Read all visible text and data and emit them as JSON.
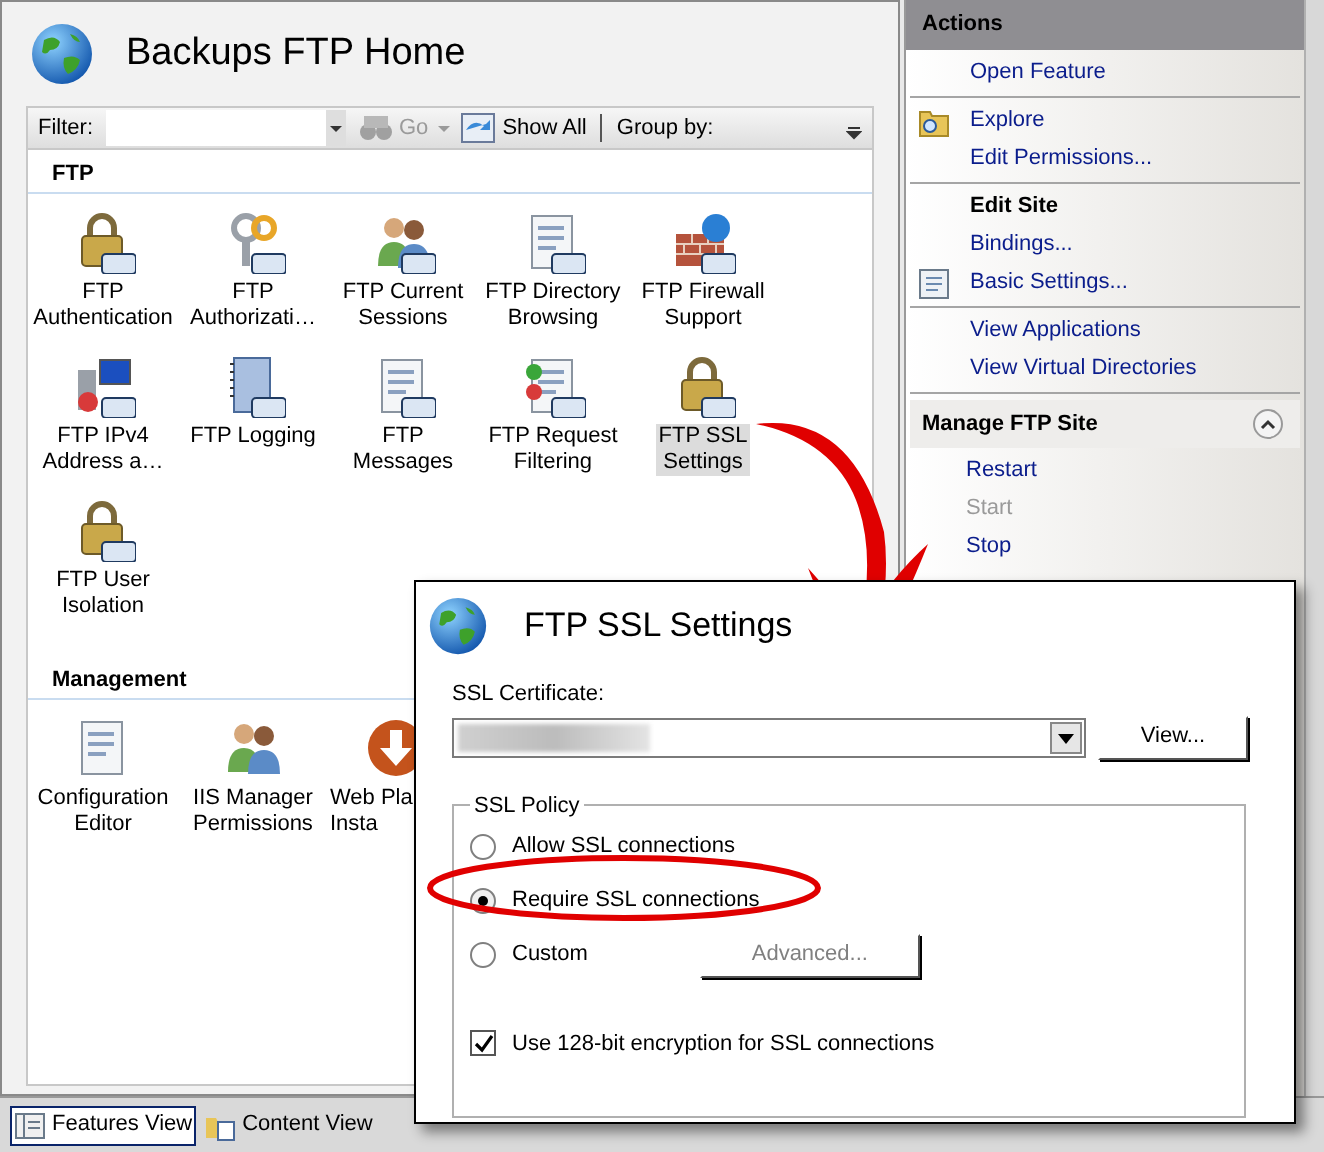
{
  "main": {
    "title": "Backups FTP Home"
  },
  "toolbar": {
    "filter_label": "Filter:",
    "go": {
      "label": "Go",
      "disabled": true
    },
    "show_all": "Show All",
    "group_by": "Group by:"
  },
  "groups": [
    {
      "title": "FTP",
      "features": [
        {
          "label": "FTP\nAuthentication",
          "selected": false,
          "cut_off": false
        },
        {
          "label": "FTP\nAuthorizati…",
          "selected": false,
          "cut_off": false
        },
        {
          "label": "FTP Current\nSessions",
          "selected": false,
          "cut_off": false
        },
        {
          "label": "FTP Directory\nBrowsing",
          "selected": false,
          "cut_off": false
        },
        {
          "label": "FTP Firewall\nSupport",
          "selected": false,
          "cut_off": false
        },
        {
          "label": "FTP IPv4\nAddress a…",
          "selected": false,
          "cut_off": false
        },
        {
          "label": "FTP Logging",
          "selected": false,
          "cut_off": false
        },
        {
          "label": "FTP Messages",
          "selected": false,
          "cut_off": false
        },
        {
          "label": "FTP Request\nFiltering",
          "selected": false,
          "cut_off": false
        },
        {
          "label": "FTP SSL\nSettings",
          "selected": true,
          "cut_off": false
        },
        {
          "label": "FTP User\nIsolation",
          "selected": false,
          "cut_off": false
        }
      ]
    },
    {
      "title": "Management",
      "features": [
        {
          "label": "Configuration\nEditor",
          "selected": false,
          "cut_off": false
        },
        {
          "label": "IIS Manager\nPermissions",
          "selected": false,
          "cut_off": false
        },
        {
          "label": "Web Pla\nInsta",
          "selected": false,
          "cut_off": true
        }
      ]
    }
  ],
  "views": [
    {
      "label": "Features View",
      "selected": true
    },
    {
      "label": "Content View",
      "selected": false
    }
  ],
  "actions": {
    "title": "Actions",
    "sections": [
      {
        "items": [
          {
            "kind": "link",
            "label": "Open Feature"
          }
        ]
      },
      {
        "items": [
          {
            "kind": "link",
            "label": "Explore"
          },
          {
            "kind": "link",
            "label": "Edit Permissions..."
          }
        ]
      },
      {
        "items": [
          {
            "kind": "heading",
            "label": "Edit Site"
          },
          {
            "kind": "link",
            "label": "Bindings..."
          },
          {
            "kind": "link",
            "label": "Basic Settings..."
          }
        ]
      },
      {
        "items": [
          {
            "kind": "link",
            "label": "View Applications"
          },
          {
            "kind": "link",
            "label": "View Virtual Directories"
          }
        ]
      }
    ],
    "manage": {
      "title": "Manage FTP Site",
      "expanded": true,
      "items": [
        {
          "label": "Restart",
          "disabled": false
        },
        {
          "label": "Start",
          "disabled": true
        },
        {
          "label": "Stop",
          "disabled": false
        }
      ]
    }
  },
  "dialog": {
    "title": "FTP SSL Settings",
    "certificate_label": "SSL Certificate:",
    "view_button": "View...",
    "policy_title": "SSL Policy",
    "options": [
      {
        "label": "Allow SSL connections",
        "selected": false
      },
      {
        "label": "Require SSL connections",
        "selected": true
      },
      {
        "label": "Custom",
        "selected": false
      }
    ],
    "advanced": {
      "label": "Advanced...",
      "disabled": true
    },
    "encryption": {
      "label": "Use 128-bit encryption for SSL connections",
      "checked": true
    }
  }
}
